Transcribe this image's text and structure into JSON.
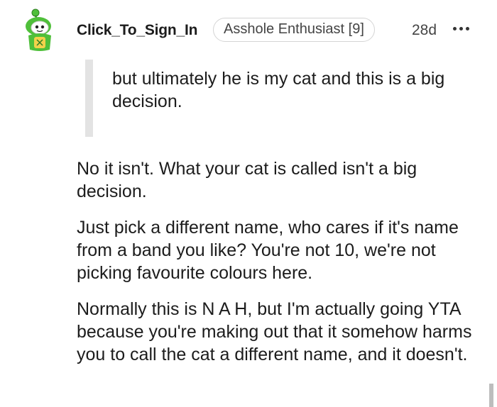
{
  "comment": {
    "username": "Click_To_Sign_In",
    "flair": "Asshole Enthusiast [9]",
    "timestamp": "28d",
    "more_icon": "more-horizontal-icon",
    "quote": "but ultimately he is my cat and this is a big decision.",
    "paragraphs": [
      "No it isn't. What your cat is called isn't a big decision.",
      "Just pick a different name, who cares if it's name from a band you like? You're not 10, we're not picking favourite colours here.",
      "Normally this is N A H, but I'm actually going YTA because you're making out that it somehow harms you to call the cat a different name, and it doesn't."
    ]
  },
  "colors": {
    "avatar_green": "#4fbf3a",
    "flair_border": "#d4d4d4",
    "quote_bar": "#e3e3e3",
    "text": "#1c1c1c"
  }
}
